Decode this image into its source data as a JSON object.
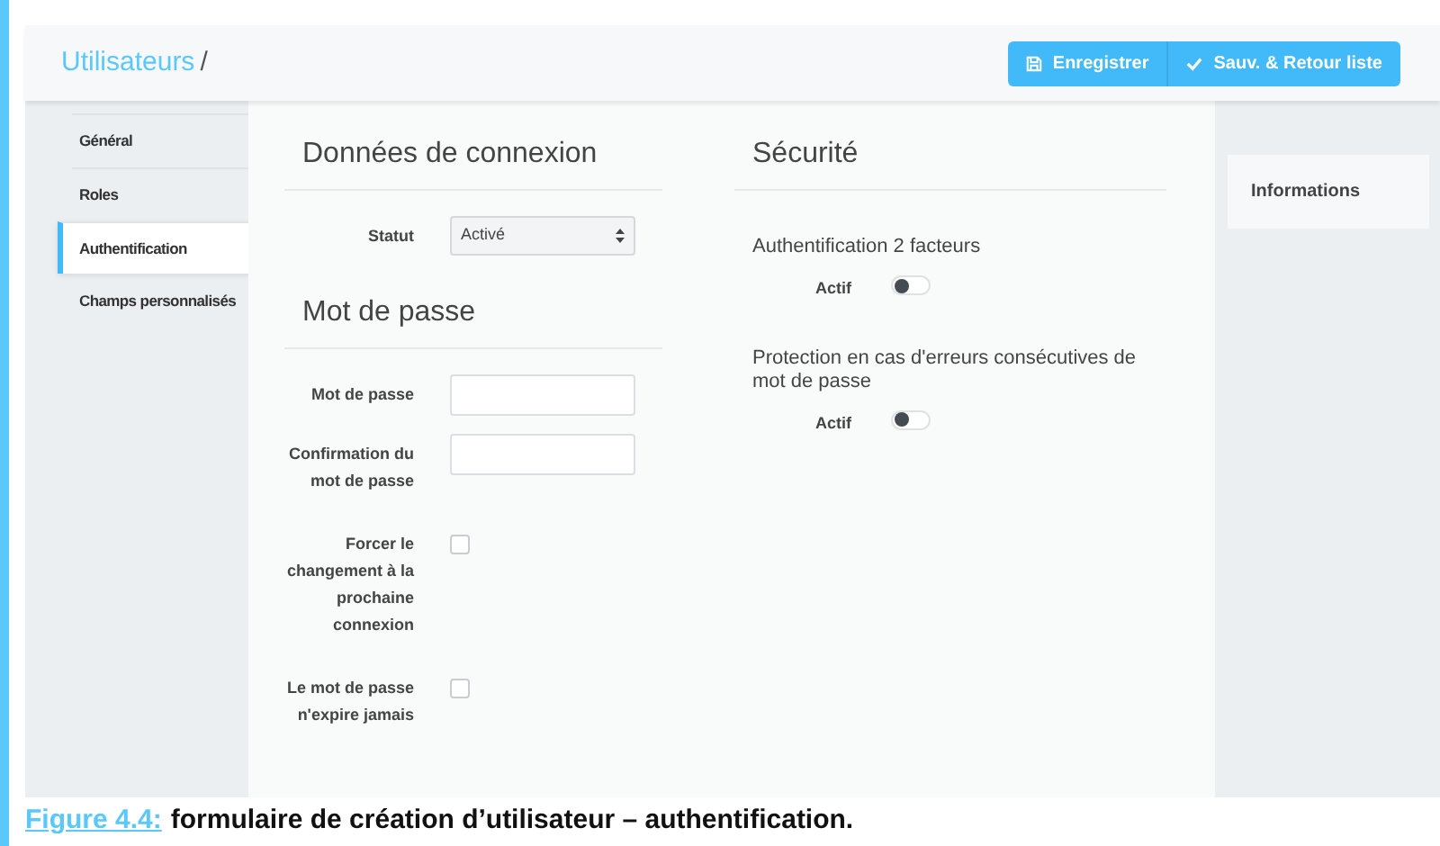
{
  "breadcrumb": {
    "link": "Utilisateurs",
    "separator": "/"
  },
  "buttons": [
    {
      "kind": "save",
      "label": "Enregistrer"
    },
    {
      "kind": "save-return",
      "label": "Sauv. & Retour liste"
    }
  ],
  "sidebar": {
    "items": [
      {
        "label": "Général",
        "selected": false
      },
      {
        "label": "Roles",
        "selected": false
      },
      {
        "label": "Authentification",
        "selected": true
      },
      {
        "label": "Champs personnalisés",
        "selected": false
      }
    ]
  },
  "connection": {
    "title": "Données de connexion",
    "status": {
      "label": "Statut",
      "value": "Activé"
    }
  },
  "password": {
    "title": "Mot de passe",
    "fields": [
      {
        "kind": "text",
        "label": "Mot de passe"
      },
      {
        "kind": "text",
        "label": "Confirmation du mot de passe"
      },
      {
        "kind": "checkbox",
        "label": "Forcer le changement à la prochaine connexion",
        "checked": false
      },
      {
        "kind": "checkbox",
        "label": "Le mot de passe n'expire jamais",
        "checked": false
      }
    ]
  },
  "security": {
    "title": "Sécurité",
    "options": [
      {
        "title": "Authentification 2 facteurs",
        "label": "Actif",
        "on": false
      },
      {
        "title": "Protection en cas d'erreurs consécutives de mot de passe",
        "label": "Actif",
        "on": false
      }
    ]
  },
  "info_panel": {
    "title": "Informations"
  },
  "caption": {
    "label": "Figure 4.4:",
    "text": "formulaire de création d’utilisateur – authentification."
  }
}
